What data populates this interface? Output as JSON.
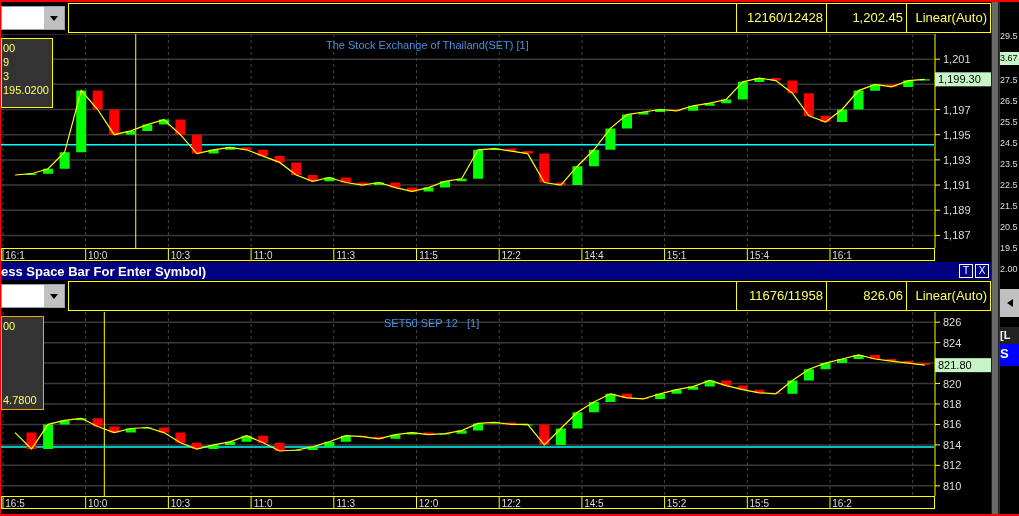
{
  "panels": [
    {
      "readouts": [
        "12160/12428",
        "1,202.45",
        "Linear(Auto)"
      ],
      "title": "The Stock Exchange of Thailand(SET) [1]",
      "info_box": [
        "00",
        "9",
        "3",
        "195.0200"
      ],
      "chart_data": {
        "type": "line",
        "grid": true,
        "ylim": [
          1186,
          1203
        ],
        "categories": [
          "16:1",
          null,
          null,
          null,
          null,
          "10:0",
          null,
          null,
          null,
          null,
          "10:3",
          null,
          null,
          null,
          null,
          "11:0",
          null,
          null,
          null,
          null,
          "11:3",
          null,
          null,
          null,
          null,
          "11:5",
          null,
          null,
          null,
          null,
          "12:2",
          null,
          null,
          null,
          null,
          "14:4",
          null,
          null,
          null,
          null,
          "15:1",
          null,
          null,
          null,
          null,
          "15:4",
          null,
          null,
          null,
          null,
          "16:1",
          null,
          null,
          null,
          null,
          null
        ],
        "yticks": [
          {
            "value": 1187,
            "label": "1,187"
          },
          {
            "value": 1189,
            "label": "1,189"
          },
          {
            "value": 1191,
            "label": "1,191"
          },
          {
            "value": 1193,
            "label": "1,193"
          },
          {
            "value": 1195,
            "label": "1,195"
          },
          {
            "value": 1197,
            "label": "1,197"
          },
          {
            "value": 1201,
            "label": "1,201"
          }
        ],
        "values": [
          1191.8,
          1191.9,
          1192.3,
          1193.6,
          1198.5,
          1197.0,
          1195.0,
          1195.3,
          1195.8,
          1196.2,
          1195.0,
          1193.5,
          1193.8,
          1194.0,
          1193.8,
          1193.3,
          1192.8,
          1191.8,
          1191.3,
          1191.6,
          1191.2,
          1191.0,
          1191.2,
          1190.8,
          1190.5,
          1190.8,
          1191.3,
          1191.5,
          1193.8,
          1193.9,
          1193.7,
          1193.5,
          1191.2,
          1191.0,
          1192.5,
          1193.8,
          1195.5,
          1196.6,
          1196.8,
          1197.0,
          1196.9,
          1197.3,
          1197.5,
          1197.8,
          1199.2,
          1199.5,
          1199.3,
          1198.3,
          1196.5,
          1196.0,
          1197.0,
          1198.5,
          1199.0,
          1198.8,
          1199.3,
          1199.4
        ],
        "ref_lines": [
          {
            "axis": "y",
            "value": 1194.2
          }
        ],
        "annotations": [
          "1,199.30"
        ]
      }
    },
    {
      "readouts": [
        "11676/11958",
        "826.06",
        "Linear(Auto)"
      ],
      "title": "SET50 SEP 12   [1]",
      "info_box": [
        "00",
        "4.7800"
      ],
      "chart_data": {
        "type": "line",
        "grid": true,
        "ylim": [
          809,
          827
        ],
        "categories": [
          "16:5",
          null,
          null,
          null,
          null,
          "10:0",
          null,
          null,
          null,
          null,
          "10:3",
          null,
          null,
          null,
          null,
          "11:0",
          null,
          null,
          null,
          null,
          "11:3",
          null,
          null,
          null,
          null,
          "12:0",
          null,
          null,
          null,
          null,
          "12:2",
          null,
          null,
          null,
          null,
          "14:5",
          null,
          null,
          null,
          null,
          "15:2",
          null,
          null,
          null,
          null,
          "15:5",
          null,
          null,
          null,
          null,
          "16:2",
          null,
          null,
          null,
          null,
          null
        ],
        "yticks": [
          {
            "value": 810,
            "label": "810"
          },
          {
            "value": 812,
            "label": "812"
          },
          {
            "value": 814,
            "label": "814"
          },
          {
            "value": 816,
            "label": "816"
          },
          {
            "value": 818,
            "label": "818"
          },
          {
            "value": 820,
            "label": "820"
          },
          {
            "value": 824,
            "label": "824"
          },
          {
            "value": 826,
            "label": "826"
          }
        ],
        "values": [
          815.2,
          813.6,
          816.0,
          816.4,
          816.6,
          815.8,
          815.2,
          815.6,
          815.7,
          815.2,
          814.2,
          813.6,
          814.0,
          814.3,
          814.9,
          814.2,
          813.4,
          813.5,
          813.8,
          814.3,
          814.9,
          814.8,
          814.6,
          815.0,
          815.2,
          815.0,
          815.1,
          815.4,
          816.1,
          816.2,
          816.0,
          816.0,
          814.0,
          815.6,
          817.2,
          818.2,
          819.0,
          818.6,
          818.5,
          819.0,
          819.4,
          819.7,
          820.3,
          819.8,
          819.4,
          819.1,
          819.0,
          820.3,
          821.4,
          822.0,
          822.4,
          822.8,
          822.4,
          822.2,
          822.0,
          821.8
        ],
        "ref_lines": [
          {
            "axis": "y",
            "value": 813.8
          }
        ],
        "annotations": [
          "821.80"
        ]
      }
    }
  ],
  "window_bar": {
    "title": "ess Space Bar For Enter Symbol)",
    "buttons": [
      "T",
      "X"
    ]
  },
  "side_panel": {
    "labels": [
      "29.5",
      "27.5",
      "26.5",
      "25.5",
      "24.5",
      "23.5",
      "22.5",
      "21.5",
      "20.5",
      "19.5",
      "2.00"
    ],
    "highlight": "3.67",
    "header": "[L",
    "tab": "S"
  }
}
